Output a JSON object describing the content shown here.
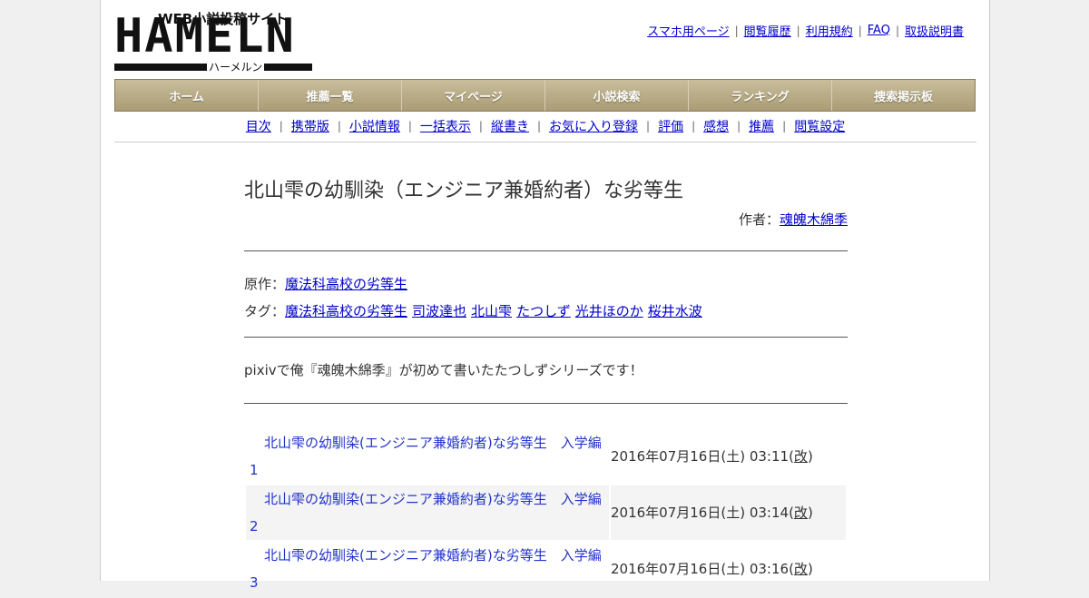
{
  "logo": {
    "main": "HAMELN",
    "sub": "WEB小説投稿サイト",
    "kana": "ハーメルン"
  },
  "top_links": [
    "スマホ用ページ",
    "閲覧履歴",
    "利用規約",
    "FAQ",
    "取扱説明書"
  ],
  "menu": [
    "ホーム",
    "推薦一覧",
    "マイページ",
    "小説検索",
    "ランキング",
    "捜索掲示板"
  ],
  "subnav": [
    "目次",
    "携帯版",
    "小説情報",
    "一括表示",
    "縦書き",
    "お気に入り登録",
    "評価",
    "感想",
    "推薦",
    "閲覧設定"
  ],
  "novel": {
    "title": "北山雫の幼馴染（エンジニア兼婚約者）な劣等生",
    "author_label": "作者：",
    "author": "魂魄木綿季",
    "original_label": "原作：",
    "original": "魔法科高校の劣等生",
    "tags_label": "タグ：",
    "tags": [
      "魔法科高校の劣等生",
      "司波達也",
      "北山雫",
      "たつしず",
      "光井ほのか",
      "桜井水波"
    ],
    "summary": "pixivで俺『魂魄木綿季』が初めて書いたたつしずシリーズです！"
  },
  "episodes": [
    {
      "title": "北山雫の幼馴染(エンジニア兼婚約者)な劣等生　入学編1",
      "date": "2016年07月16日(土) 03:11",
      "revised": "改"
    },
    {
      "title": "北山雫の幼馴染(エンジニア兼婚約者)な劣等生　入学編2",
      "date": "2016年07月16日(土) 03:14",
      "revised": "改"
    },
    {
      "title": "北山雫の幼馴染(エンジニア兼婚約者)な劣等生　入学編3",
      "date": "2016年07月16日(土) 03:16",
      "revised": "改"
    }
  ]
}
